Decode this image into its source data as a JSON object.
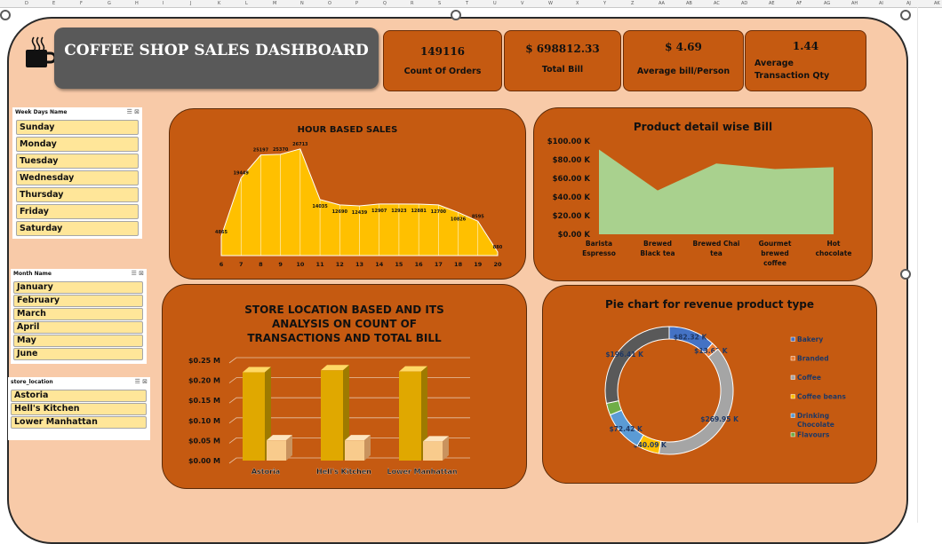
{
  "column_headers": [
    "D",
    "E",
    "F",
    "G",
    "H",
    "I",
    "J",
    "K",
    "L",
    "M",
    "N",
    "O",
    "P",
    "Q",
    "R",
    "S",
    "T",
    "U",
    "V",
    "W",
    "X",
    "Y",
    "Z",
    "AA",
    "AB",
    "AC",
    "AD",
    "AE",
    "AF",
    "AG",
    "AH",
    "AI",
    "AJ",
    "AK"
  ],
  "title": "COFFEE SHOP SALES DASHBOARD",
  "icons": {
    "cup": "coffee-cup-icon",
    "filter": "multi-select-icon",
    "clear": "clear-filter-icon"
  },
  "colors": {
    "panel": "#c55a11",
    "background": "#f8caa8",
    "title_box": "#595959",
    "slicer_item": "#ffe699",
    "hour_area": "#ffc000",
    "product_area": "#a9d18e"
  },
  "kpis": [
    {
      "value": "149116",
      "label": "Count Of Orders"
    },
    {
      "value": "$ 698812.33",
      "label": "Total Bill"
    },
    {
      "value": "$ 4.69",
      "label": "Average bill/Person"
    },
    {
      "value": "1.44",
      "label_line1": "Average",
      "label_line2": "Transaction Qty"
    }
  ],
  "slicers": {
    "weekday": {
      "header": "Week Days Name",
      "items": [
        "Sunday",
        "Monday",
        "Tuesday",
        "Wednesday",
        "Thursday",
        "Friday",
        "Saturday"
      ]
    },
    "month": {
      "header": "Month Name",
      "items": [
        "January",
        "February",
        "March",
        "April",
        "May",
        "June"
      ]
    },
    "store": {
      "header": "store_location",
      "items": [
        "Astoria",
        "Hell's Kitchen",
        "Lower Manhattan"
      ]
    }
  },
  "chart_data": [
    {
      "type": "area",
      "title": "HOUR BASED SALES",
      "x": [
        6,
        7,
        8,
        9,
        10,
        11,
        12,
        13,
        14,
        15,
        16,
        17,
        18,
        19,
        20
      ],
      "values": [
        4865,
        19449,
        25197,
        25370,
        26713,
        14035,
        12690,
        12439,
        12907,
        12923,
        12881,
        12700,
        10826,
        8595,
        880
      ],
      "value_labels": [
        "4865",
        "19449",
        "25197",
        "25370",
        "26713",
        "14035",
        "12690",
        "12439",
        "12907",
        "12923",
        "12881",
        "12700",
        "10826",
        "8595",
        "880"
      ],
      "ylim": [
        0,
        30000
      ],
      "grid": false
    },
    {
      "type": "area",
      "title": "Product detail wise Bill",
      "categories": [
        "Barista Espresso",
        "Brewed Black tea",
        "Brewed Chai tea",
        "Gourmet brewed coffee",
        "Hot chocolate"
      ],
      "category_lines": [
        [
          "Barista",
          "Espresso"
        ],
        [
          "Brewed",
          "Black tea"
        ],
        [
          "Brewed Chai",
          "tea"
        ],
        [
          "Gourmet",
          "brewed",
          "coffee"
        ],
        [
          "Hot",
          "chocolate"
        ]
      ],
      "values": [
        91,
        47,
        76,
        70,
        72
      ],
      "unit": "thousand dollars",
      "yticks": [
        "$0.00 K",
        "$20.00 K",
        "$40.00 K",
        "$60.00 K",
        "$80.00 K",
        "$100.00 K"
      ],
      "ylim": [
        0,
        100
      ],
      "grid": false
    },
    {
      "type": "bar",
      "title_lines": [
        "STORE LOCATION BASED AND ITS",
        "ANALYSIS ON COUNT OF",
        "TRANSACTIONS AND TOTAL BILL"
      ],
      "categories": [
        "Astoria",
        "Hell's Kitchen",
        "Lower Manhattan"
      ],
      "series": [
        {
          "values": [
            0.22,
            0.225,
            0.222
          ]
        },
        {
          "values": [
            0.0505,
            0.0505,
            0.0478
          ]
        }
      ],
      "unit": "million",
      "yticks": [
        "$0.00 M",
        "$0.05 M",
        "$0.10 M",
        "$0.15 M",
        "$0.20 M",
        "$0.25 M"
      ],
      "ylim": [
        0,
        0.25
      ],
      "grid": true
    },
    {
      "type": "pie",
      "title": "Pie chart for revenue product type",
      "legend_position": "right",
      "slices": [
        {
          "name": "Bakery",
          "value": 82.32,
          "label": "$82.32 K",
          "color": "#4472c4"
        },
        {
          "name": "Branded",
          "value": 13.61,
          "label": "$13.61 K",
          "color": "#ed7d31"
        },
        {
          "name": "Coffee",
          "value": 269.95,
          "label": "$269.95 K",
          "color": "#a5a5a5"
        },
        {
          "name": "Coffee beans",
          "value": 40.09,
          "label": "$40.09 K",
          "color": "#ffc000"
        },
        {
          "name": "Drinking Chocolate",
          "value": 72.42,
          "label": "$72.42 K",
          "color": "#5b9bd5"
        },
        {
          "name": "Flavours",
          "value": 21.15,
          "label": "",
          "color": "#70ad47"
        },
        {
          "name": "",
          "value": 196.41,
          "label": "$196.41 K",
          "color": "#595959"
        }
      ],
      "legend": [
        {
          "name": "Bakery",
          "color": "#4472c4"
        },
        {
          "name": "Branded",
          "color": "#ed7d31"
        },
        {
          "name": "Coffee",
          "color": "#a5a5a5"
        },
        {
          "name": "Coffee beans",
          "color": "#ffc000"
        },
        {
          "name": "Drinking",
          "name2": "Chocolate",
          "color": "#5b9bd5"
        },
        {
          "name": "Flavours",
          "color": "#70ad47"
        }
      ]
    }
  ]
}
